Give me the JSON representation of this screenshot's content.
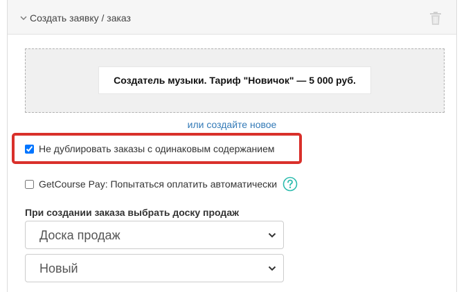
{
  "header": {
    "title": "Создать заявку / заказ",
    "collapse_icon": "chevron-down-icon",
    "delete_icon": "trash-icon"
  },
  "offer": {
    "selected_label": "Создатель музыки. Тариф \"Новичок\" — 5 000 руб."
  },
  "create_new_link": "или создайте новое",
  "options": {
    "no_duplicate": {
      "label": "Не дублировать заказы с одинаковым содержанием",
      "checked": true
    },
    "getcourse_pay": {
      "label": "GetCourse Pay: Попытаться оплатить автоматически",
      "checked": false,
      "help_icon": "question-circle-icon"
    }
  },
  "sales_board": {
    "label": "При создании заказа выбрать доску продаж",
    "board_value": "Доска продаж",
    "status_value": "Новый"
  },
  "colors": {
    "link": "#337ab7",
    "highlight": "#d9302b",
    "help_icon": "#2bbbad"
  }
}
